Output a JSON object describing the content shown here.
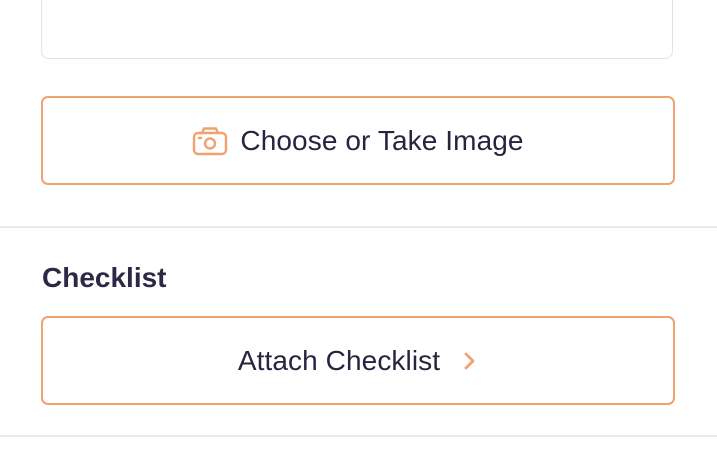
{
  "image_picker": {
    "label": "Choose or Take Image",
    "icon": "camera-icon"
  },
  "checklist_section": {
    "title": "Checklist",
    "attach_label": "Attach Checklist",
    "attach_icon": "chevron-right-icon"
  },
  "colors": {
    "accent": "#f0a270",
    "text": "#26243f",
    "border": "#e1e3e6",
    "divider": "#e8eaed"
  }
}
